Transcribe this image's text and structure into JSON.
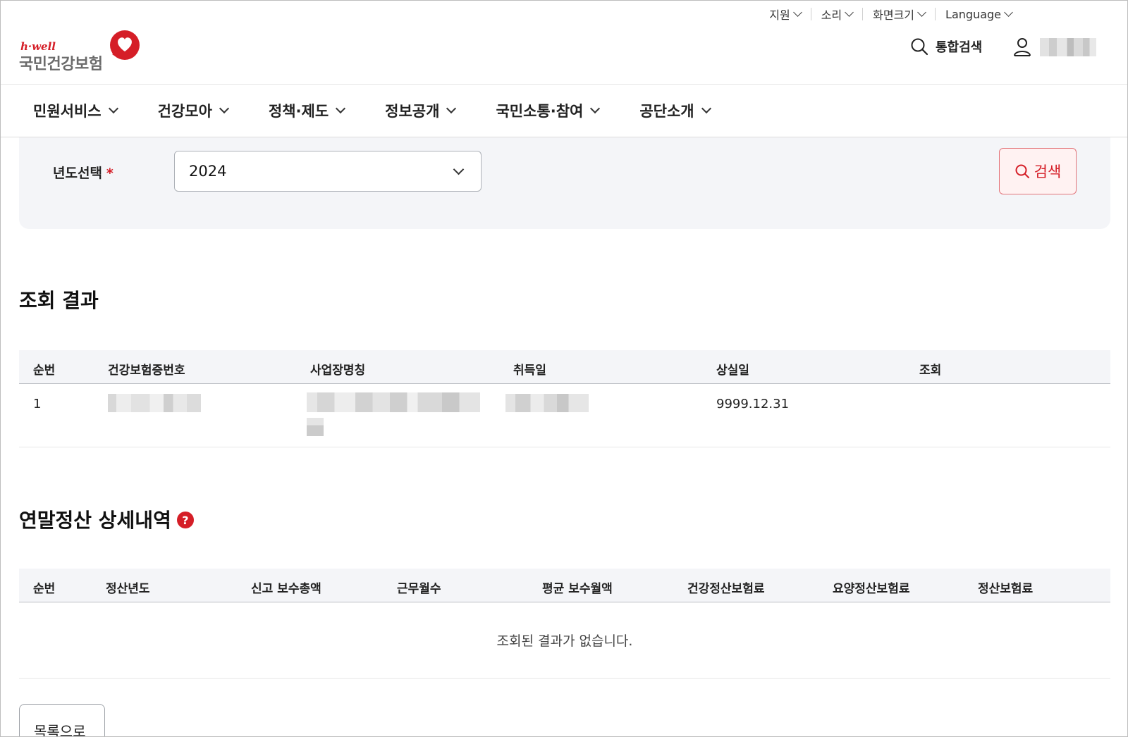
{
  "utility": {
    "items": [
      {
        "label": "지원"
      },
      {
        "label": "소리"
      },
      {
        "label": "화면크기"
      },
      {
        "label": "Language"
      }
    ]
  },
  "header": {
    "logo_small": "h·well",
    "logo_big": "국민건강보험",
    "search_label": "통합검색"
  },
  "gnb": {
    "items": [
      {
        "label": "민원서비스"
      },
      {
        "label": "건강모아"
      },
      {
        "label": "정책·제도"
      },
      {
        "label": "정보공개"
      },
      {
        "label": "국민소통·참여"
      },
      {
        "label": "공단소개"
      }
    ]
  },
  "search": {
    "year_label": "년도선택",
    "required_mark": "*",
    "year_value": "2024",
    "button_label": "검색"
  },
  "result": {
    "title": "조회 결과",
    "columns": [
      "순번",
      "건강보험증번호",
      "사업장명칭",
      "취득일",
      "상실일",
      "조회"
    ],
    "rows": [
      {
        "no": "1",
        "loss_date": "9999.12.31"
      }
    ]
  },
  "detail": {
    "title": "연말정산 상세내역",
    "help_icon": "?",
    "columns": [
      "순번",
      "정산년도",
      "신고 보수총액",
      "근무월수",
      "평균 보수월액",
      "건강정산보험료",
      "요양정산보험료",
      "정산보험료"
    ],
    "empty_message": "조회된 결과가 없습니다."
  },
  "footer": {
    "list_button": "목록으로"
  },
  "colors": {
    "brand_red": "#d51e27",
    "panel_bg": "#f4f5f8"
  }
}
